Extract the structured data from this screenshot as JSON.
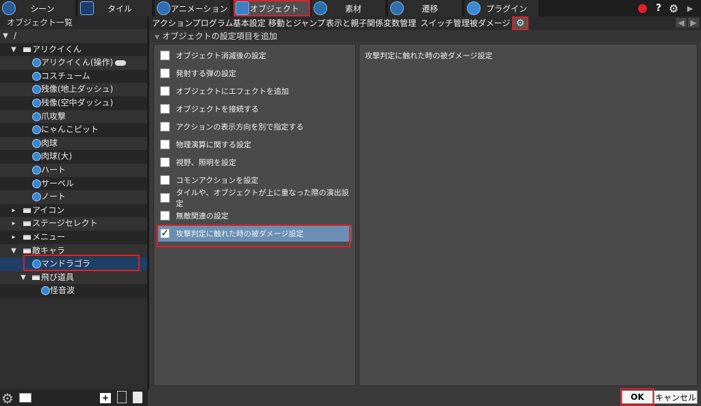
{
  "top_tabs": [
    {
      "label": "シーン",
      "icon": "scene-icon"
    },
    {
      "label": "タイル",
      "icon": "tile-icon"
    },
    {
      "label": "アニメーション",
      "icon": "animation-icon"
    },
    {
      "label": "オブジェクト",
      "icon": "object-icon",
      "active": true
    },
    {
      "label": "素材",
      "icon": "material-icon"
    },
    {
      "label": "遷移",
      "icon": "transition-icon"
    },
    {
      "label": "プラグイン",
      "icon": "plugin-icon"
    }
  ],
  "top_right": {
    "help": "?"
  },
  "left_panel": {
    "title": "オブジェクト一覧",
    "root": "/",
    "tree": [
      {
        "label": "アリクイくん",
        "type": "folder"
      },
      {
        "label": "アリクイくん(操作)",
        "type": "object",
        "badge": "gamepad-icon"
      },
      {
        "label": "コスチューム",
        "type": "object"
      },
      {
        "label": "残像(地上ダッシュ)",
        "type": "object"
      },
      {
        "label": "残像(空中ダッシュ)",
        "type": "object"
      },
      {
        "label": "爪攻撃",
        "type": "object"
      },
      {
        "label": "にゃんこピット",
        "type": "object"
      },
      {
        "label": "肉球",
        "type": "object"
      },
      {
        "label": "肉球(大)",
        "type": "object"
      },
      {
        "label": "ハート",
        "type": "object"
      },
      {
        "label": "サーベル",
        "type": "object"
      },
      {
        "label": "ノート",
        "type": "object"
      },
      {
        "label": "アイコン",
        "type": "folder"
      },
      {
        "label": "ステージセレクト",
        "type": "folder"
      },
      {
        "label": "メニュー",
        "type": "folder"
      },
      {
        "label": "敵キャラ",
        "type": "folder"
      },
      {
        "label": "マンドラゴラ",
        "type": "object",
        "selected": true
      },
      {
        "label": "飛び道具",
        "type": "folder"
      },
      {
        "label": "怪音波",
        "type": "object"
      }
    ]
  },
  "sub_tabs": [
    "アクションプログラム",
    "基本設定",
    "移動とジャンプ",
    "表示と親子関係",
    "変数管理",
    "スイッチ管理",
    "被ダメージ"
  ],
  "section_title": "オブジェクトの設定項目を追加",
  "options": [
    {
      "label": "オブジェクト消滅後の設定",
      "checked": false
    },
    {
      "label": "発射する弾の設定",
      "checked": false
    },
    {
      "label": "オブジェクトにエフェクトを追加",
      "checked": false
    },
    {
      "label": "オブジェクトを接続する",
      "checked": false
    },
    {
      "label": "アクションの表示方向を別で指定する",
      "checked": false
    },
    {
      "label": "物理演算に関する設定",
      "checked": false
    },
    {
      "label": "視野、照明を設定",
      "checked": false
    },
    {
      "label": "コモンアクションを設定",
      "checked": false
    },
    {
      "label": "タイルや、オブジェクトが上に重なった際の演出設定",
      "checked": false
    },
    {
      "label": "無敵関連の設定",
      "checked": false
    },
    {
      "label": "攻撃判定に触れた時の被ダメージ設定",
      "checked": true
    }
  ],
  "description": "攻撃判定に触れた時の被ダメージ設定",
  "buttons": {
    "ok": "OK",
    "cancel": "キャンセル"
  },
  "colors": {
    "accent_red": "#e0202a",
    "selected_blue": "#1f3f66",
    "checked_row": "#6a8fb3"
  }
}
